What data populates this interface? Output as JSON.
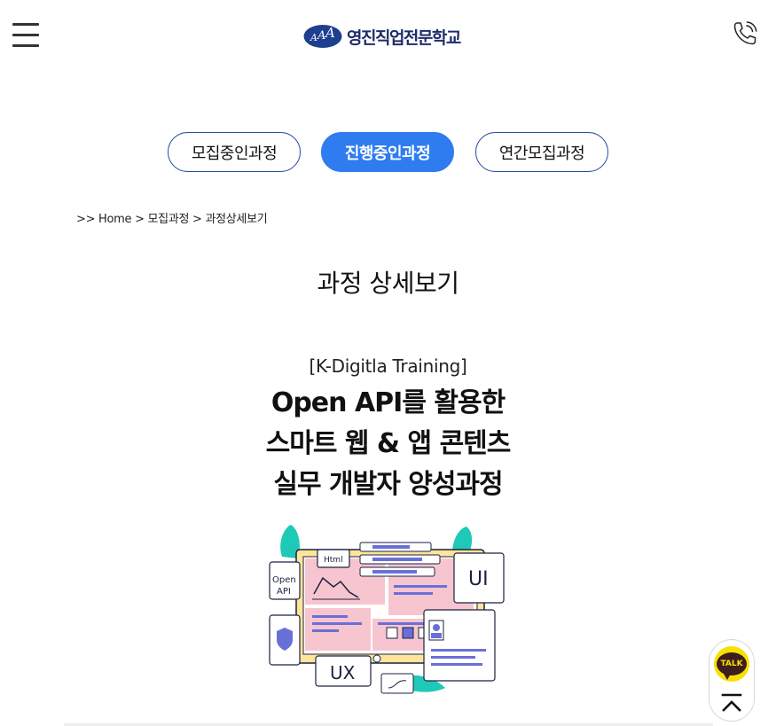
{
  "header": {
    "logo_text": "영진직업전문학교",
    "logo_icon": "yjac-logo-icon",
    "menu_icon": "hamburger-menu-icon",
    "phone_icon": "phone-icon"
  },
  "tabs": [
    {
      "label": "모집중인과정",
      "active": false
    },
    {
      "label": "진행중인과정",
      "active": true
    },
    {
      "label": "연간모집과정",
      "active": false
    }
  ],
  "breadcrumb": {
    "prefix": ">>",
    "home": "Home",
    "sep1": ">",
    "level1": "모집과정",
    "sep2": ">",
    "current": "과정상세보기"
  },
  "page_title": "과정 상세보기",
  "course": {
    "subtitle": "[K-Digitla Training]",
    "title_line1": "Open API를 활용한",
    "title_line2": "스마트 웹 & 앱 콘텐츠",
    "title_line3": "실무 개발자 양성과정"
  },
  "illustration": {
    "html_label": "Html",
    "openapi_label1": "Open",
    "openapi_label2": "API",
    "ui_label": "UI",
    "ux_label": "UX"
  },
  "float": {
    "kakao_label": "TALK",
    "top_icon": "scroll-to-top-icon"
  },
  "colors": {
    "accent": "#2f7bf0",
    "tab_border": "#2b4fa8",
    "logo_navy": "#1e2d6a",
    "kakao_yellow": "#f9e000"
  }
}
